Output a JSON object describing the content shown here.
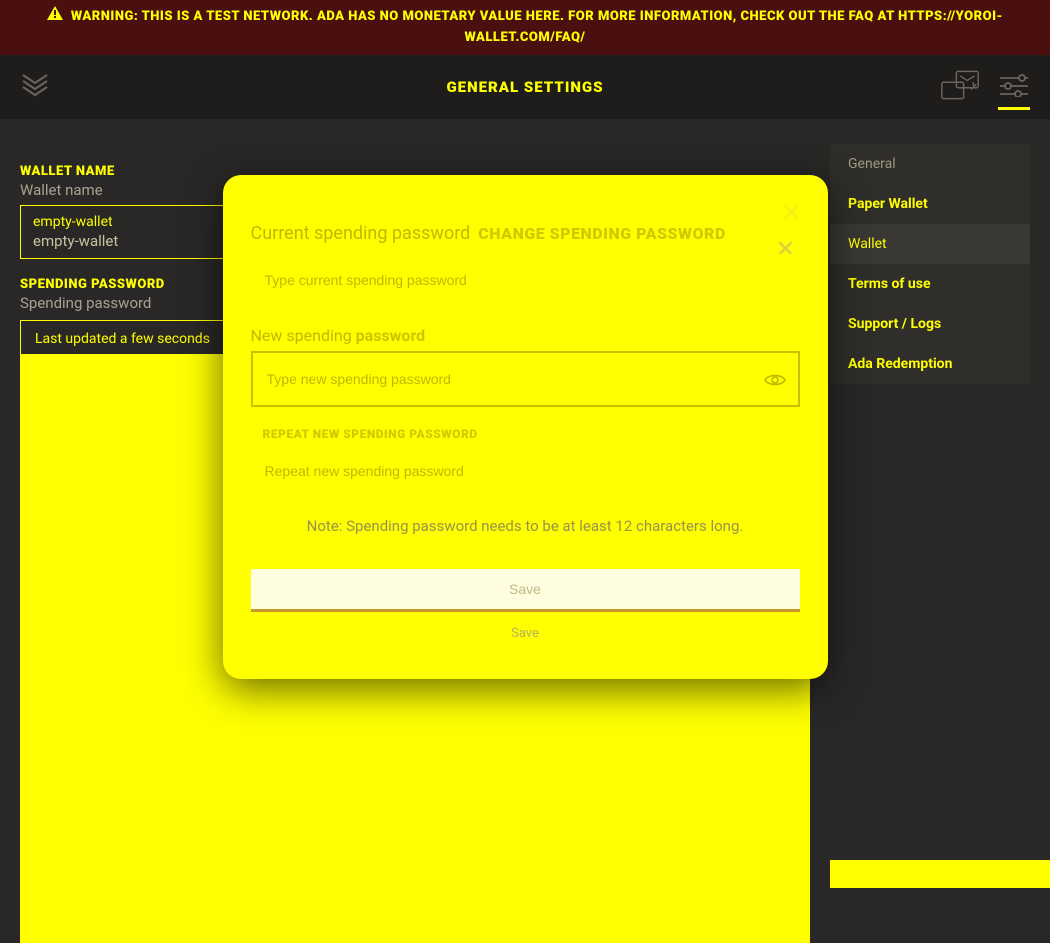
{
  "warning": {
    "text": "WARNING: THIS IS A TEST NETWORK. ADA HAS NO MONETARY VALUE HERE. FOR MORE INFORMATION, CHECK OUT THE FAQ AT HTTPS://YOROI-WALLET.COM/FAQ/"
  },
  "header": {
    "title": "GENERAL SETTINGS"
  },
  "wallet_name": {
    "label": "WALLET NAME",
    "sublabel": "Wallet name",
    "value": "empty-wallet",
    "value2": "empty-wallet"
  },
  "spending": {
    "label": "SPENDING PASSWORD",
    "sublabel": "Spending password",
    "updated1": "Last updated a few seconds",
    "updated2": "Last updated a few seconds"
  },
  "sidebar": {
    "items": [
      {
        "label": "General"
      },
      {
        "label": "Paper Wallet"
      },
      {
        "label": "Wallet"
      },
      {
        "label": "Terms of use"
      },
      {
        "label": "Support / Logs"
      },
      {
        "label": "Ada Redemption"
      }
    ]
  },
  "modal": {
    "current_label": "Current spending password",
    "title": "CHANGE SPENDING PASSWORD",
    "current_placeholder": "Type current spending password",
    "new_label_prefix": "New spending",
    "new_label_bold": "password",
    "new_placeholder": "Type new spending password",
    "new_placeholder2": "Type new spending password",
    "repeat_label": "REPEAT NEW SPENDING PASSWORD",
    "repeat_label2": "Repeat new spending password",
    "note": "Note: Spending password needs to be at least 12 characters long.",
    "save": "Save",
    "save2": "Save"
  }
}
